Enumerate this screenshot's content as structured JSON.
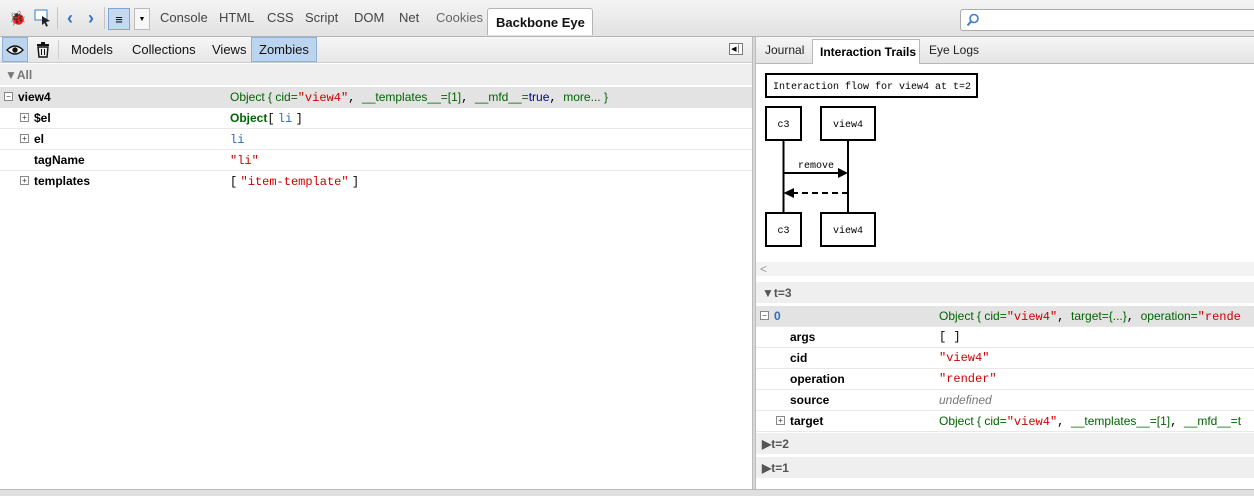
{
  "toolbar": {
    "tabs": [
      "Console",
      "HTML",
      "CSS",
      "Script",
      "DOM",
      "Net",
      "Cookies"
    ],
    "active_tab": "Backbone Eye",
    "search_placeholder": ""
  },
  "left": {
    "subtabs": [
      "Models",
      "Collections",
      "Views",
      "Zombies"
    ],
    "active_subtab": "Zombies",
    "group_label": "All",
    "object_name": "view4",
    "object_summary": {
      "prefix": "Object {",
      "cid_key": "cid=",
      "cid_val": "\"view4\"",
      "sep1": ",",
      "templates": "__templates__=[1]",
      "sep2": ",",
      "mfd_key": "__mfd__=",
      "mfd_val": "true",
      "sep3": ",",
      "more": "more...",
      "suffix": "}"
    },
    "props": [
      {
        "key": "$el",
        "val_obj": "Object",
        "val_open": "[",
        "val_elem": "li",
        "val_close": "]"
      },
      {
        "key": "el",
        "val_elem": "li"
      },
      {
        "key": "tagName",
        "val_str": "\"li\""
      },
      {
        "key": "templates",
        "val_open": "[",
        "val_str": "\"item-template\"",
        "val_close": "]"
      }
    ]
  },
  "right": {
    "tabs": [
      "Journal",
      "Interaction Trails",
      "Eye Logs"
    ],
    "active_tab": "Interaction Trails",
    "diagram": {
      "title": "Interaction flow for view4 at t=2",
      "left_actor": "c3",
      "right_actor": "view4",
      "message": "remove"
    },
    "scroll_arrow": "<",
    "groups": [
      "t=3",
      "t=2",
      "t=1"
    ],
    "entry": {
      "index": "0",
      "summary": {
        "prefix": "Object {",
        "cid_key": "cid=",
        "cid_val": "\"view4\"",
        "sep1": ",",
        "target": "target={...}",
        "sep2": ",",
        "op_key": "operation=",
        "op_val": "\"rende"
      },
      "props": [
        {
          "key": "args",
          "val": "[ ]"
        },
        {
          "key": "cid",
          "val": "\"view4\""
        },
        {
          "key": "operation",
          "val": "\"render\""
        },
        {
          "key": "source",
          "val": "undefined"
        }
      ],
      "target_row": {
        "key": "target",
        "prefix": "Object {",
        "cid_key": "cid=",
        "cid_val": "\"view4\"",
        "sep1": ",",
        "templates": "__templates__=[1]",
        "sep2": ",",
        "mfd": "__mfd__=t"
      }
    }
  }
}
